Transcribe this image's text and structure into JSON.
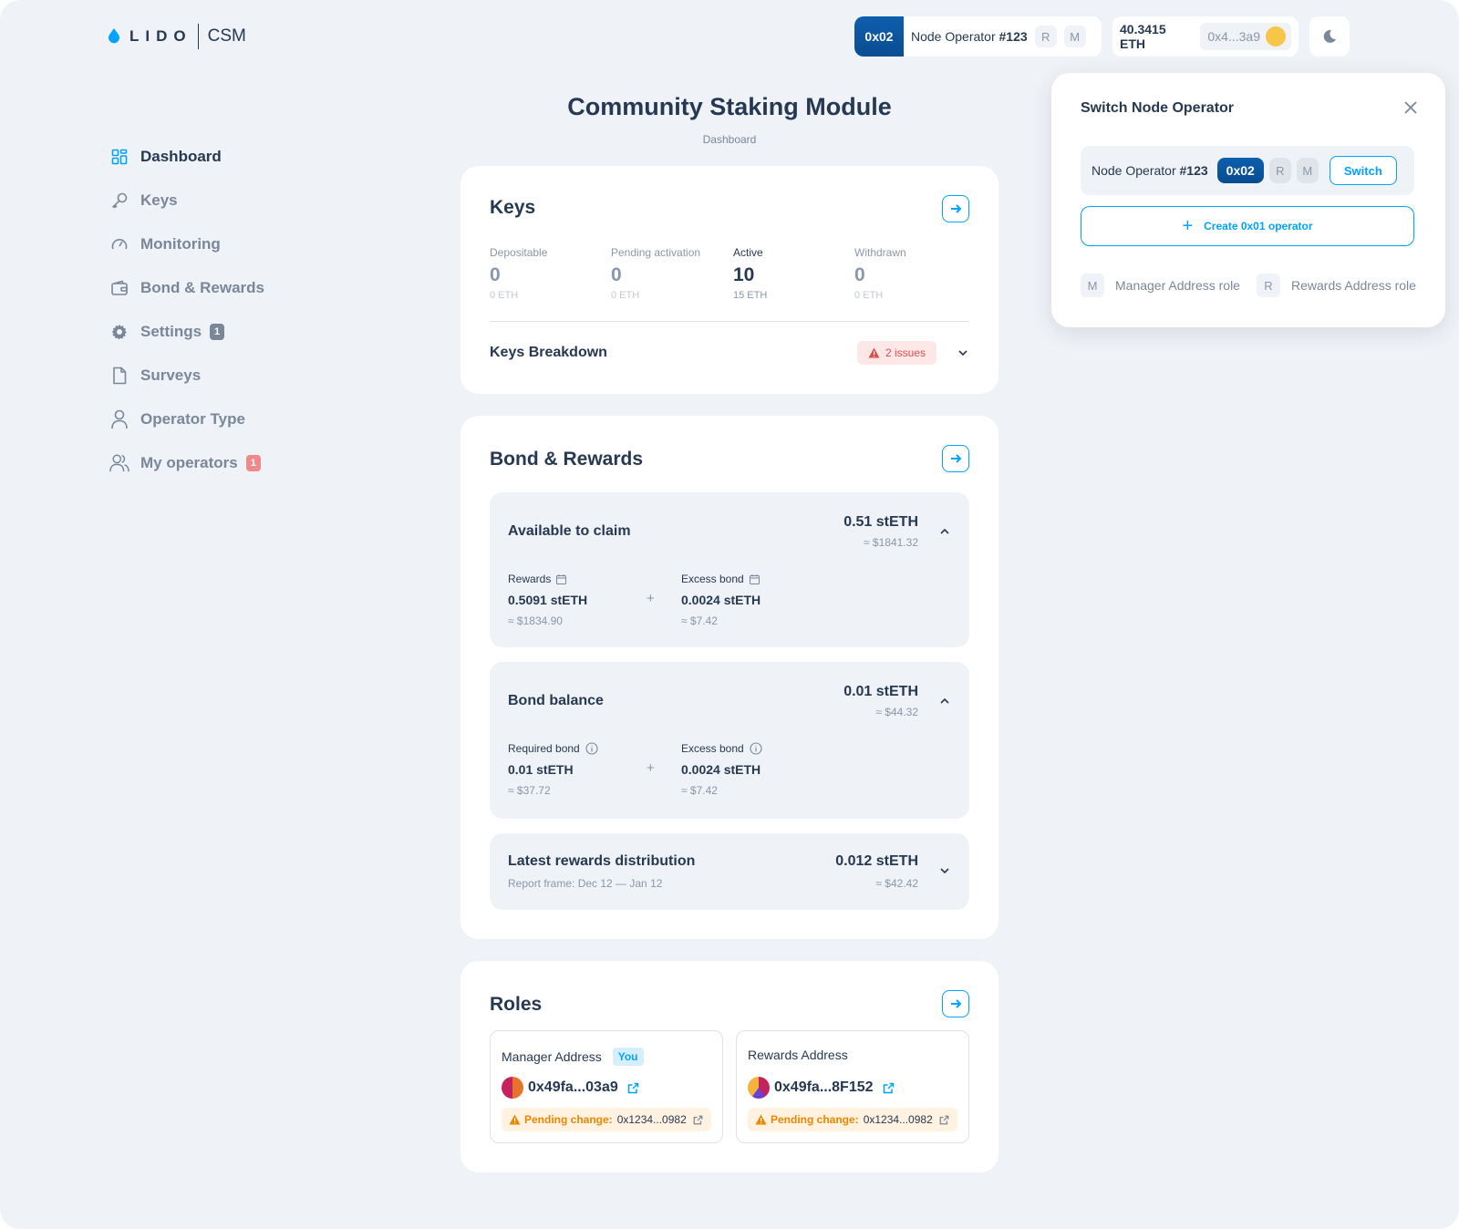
{
  "header": {
    "logo_text": "LIDO",
    "module_text": "CSM",
    "operator_tag": "0x02",
    "operator_name_prefix": "Node Operator",
    "operator_name_number": "#123",
    "role_r": "R",
    "role_m": "M",
    "balance": "40.3415 ETH",
    "wallet_address": "0x4...3a9"
  },
  "sidebar": {
    "items": [
      {
        "label": "Dashboard",
        "icon": "dashboard-icon"
      },
      {
        "label": "Keys",
        "icon": "key-icon"
      },
      {
        "label": "Monitoring",
        "icon": "gauge-icon"
      },
      {
        "label": "Bond & Rewards",
        "icon": "wallet-icon"
      },
      {
        "label": "Settings",
        "icon": "gear-icon",
        "badge": "1"
      },
      {
        "label": "Surveys",
        "icon": "document-icon"
      },
      {
        "label": "Operator Type",
        "icon": "user-icon"
      },
      {
        "label": "My operators",
        "icon": "users-icon",
        "badge": "1"
      }
    ]
  },
  "page": {
    "title": "Community Staking Module",
    "breadcrumb": "Dashboard"
  },
  "keys": {
    "title": "Keys",
    "columns": [
      {
        "label": "Depositable",
        "value": "0",
        "eth": "0 ETH"
      },
      {
        "label": "Pending activation",
        "value": "0",
        "eth": "0 ETH"
      },
      {
        "label": "Active",
        "value": "10",
        "eth": "15 ETH"
      },
      {
        "label": "Withdrawn",
        "value": "0",
        "eth": "0 ETH"
      }
    ],
    "breakdown_label": "Keys Breakdown",
    "issues_label": "2 issues"
  },
  "bond": {
    "title": "Bond & Rewards",
    "available": {
      "title": "Available to claim",
      "amount": "0.51 stETH",
      "usd": "≈ $1841.32",
      "left_label": "Rewards",
      "left_value": "0.5091 stETH",
      "left_usd": "≈ $1834.90",
      "right_label": "Excess bond",
      "right_value": "0.0024 stETH",
      "right_usd": "≈ $7.42"
    },
    "balance": {
      "title": "Bond balance",
      "amount": "0.01 stETH",
      "usd": "≈ $44.32",
      "left_label": "Required bond",
      "left_value": "0.01 stETH",
      "left_usd": "≈ $37.72",
      "right_label": "Excess bond",
      "right_value": "0.0024 stETH",
      "right_usd": "≈ $7.42"
    },
    "latest": {
      "title": "Latest rewards distribution",
      "note": "Report frame: Dec 12 — Jan 12",
      "amount": "0.012 stETH",
      "usd": "≈ $42.42"
    },
    "plus": "+"
  },
  "roles": {
    "title": "Roles",
    "manager": {
      "label": "Manager Address",
      "you": "You",
      "address": "0x49fa...03a9",
      "pending_label": "Pending change:",
      "pending_address": "0x1234...0982"
    },
    "rewards": {
      "label": "Rewards Address",
      "address": "0x49fa...8F152",
      "pending_label": "Pending change:",
      "pending_address": "0x1234...0982"
    }
  },
  "popup": {
    "title": "Switch Node Operator",
    "operator_prefix": "Node Operator",
    "operator_number": "#123",
    "operator_tag": "0x02",
    "role_r": "R",
    "role_m": "M",
    "switch_label": "Switch",
    "create_label": "Create 0x01 operator",
    "legend_m": "M",
    "legend_m_label": "Manager Address role",
    "legend_r": "R",
    "legend_r_label": "Rewards Address role"
  },
  "colors": {
    "accent": "#00a3ff",
    "text": "#273852",
    "muted": "#7a8799",
    "background": "#eff2f6",
    "warning": "#ec8600",
    "danger": "#e14d4d"
  }
}
